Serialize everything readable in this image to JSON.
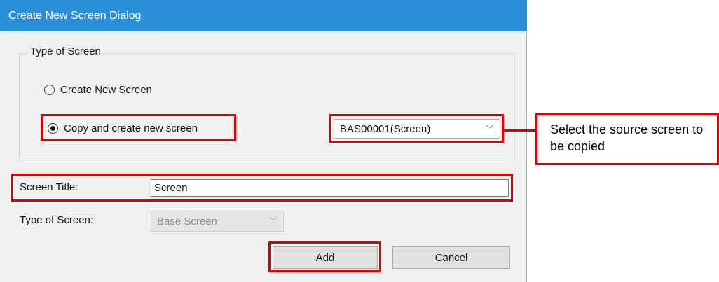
{
  "dialog": {
    "title": "Create New Screen Dialog",
    "group_legend": "Type of Screen",
    "radio_new_label": "Create New Screen",
    "radio_copy_label": "Copy and create new screen",
    "source_screen_value": "BAS00001(Screen)",
    "screen_title_label": "Screen Title:",
    "screen_title_value": "Screen",
    "type_label": "Type of Screen:",
    "type_value": "Base Screen",
    "add_label": "Add",
    "cancel_label": "Cancel"
  },
  "annotation": {
    "callout_text": "Select the source screen to be copied",
    "highlight_color": "#e00000"
  },
  "colors": {
    "titlebar": "#2b8fd7",
    "dialog_bg": "#f0f0f0"
  },
  "icons": {
    "dropdown": "chevron-down-icon"
  },
  "state": {
    "selected_radio": "copy"
  }
}
